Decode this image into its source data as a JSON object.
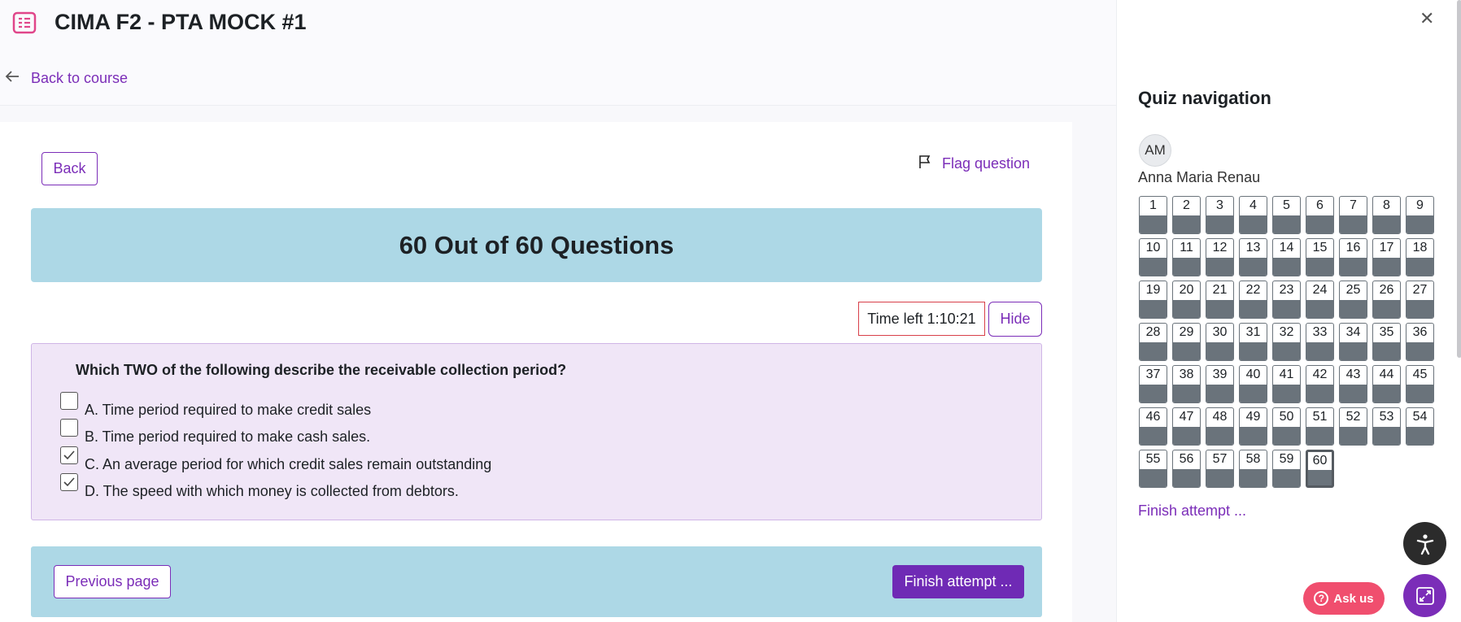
{
  "header": {
    "title": "CIMA F2 - PTA MOCK #1",
    "back_link": "Back to course"
  },
  "question_header": {
    "back_button": "Back",
    "flag_button": "Flag question",
    "count_banner": "60 Out of 60 Questions"
  },
  "timer": {
    "label": "Time left 1:10:21",
    "hide_button": "Hide"
  },
  "question": {
    "text": "Which TWO of the following describe the receivable collection period?",
    "options": [
      {
        "label": "A. Time period required to make credit sales",
        "checked": false
      },
      {
        "label": "B. Time period required to make cash sales.",
        "checked": false
      },
      {
        "label": "C. An average period for which credit sales remain outstanding",
        "checked": true
      },
      {
        "label": "D. The speed with which money is collected from debtors.",
        "checked": true
      }
    ]
  },
  "page_nav": {
    "previous_button": "Previous page",
    "finish_button": "Finish attempt ..."
  },
  "quiz_navigation": {
    "close_icon": "close-icon",
    "title": "Quiz navigation",
    "avatar_initials": "AM",
    "user_name": "Anna Maria Renau",
    "question_numbers": [
      "1",
      "2",
      "3",
      "4",
      "5",
      "6",
      "7",
      "8",
      "9",
      "10",
      "11",
      "12",
      "13",
      "14",
      "15",
      "16",
      "17",
      "18",
      "19",
      "20",
      "21",
      "22",
      "23",
      "24",
      "25",
      "26",
      "27",
      "28",
      "29",
      "30",
      "31",
      "32",
      "33",
      "34",
      "35",
      "36",
      "37",
      "38",
      "39",
      "40",
      "41",
      "42",
      "43",
      "44",
      "45",
      "46",
      "47",
      "48",
      "49",
      "50",
      "51",
      "52",
      "53",
      "54",
      "55",
      "56",
      "57",
      "58",
      "59",
      "60"
    ],
    "current_question": "60",
    "finish_link": "Finish attempt ..."
  },
  "floating": {
    "ask_button": "Ask us",
    "accessibility_icon": "accessibility-icon",
    "expand_icon": "expand-icon"
  },
  "colors": {
    "accent": "#7b2db8",
    "banner": "#add8e6",
    "question_panel": "#f0e6f7",
    "timer_border": "#d83f49",
    "ask_button": "#f04e6e"
  }
}
